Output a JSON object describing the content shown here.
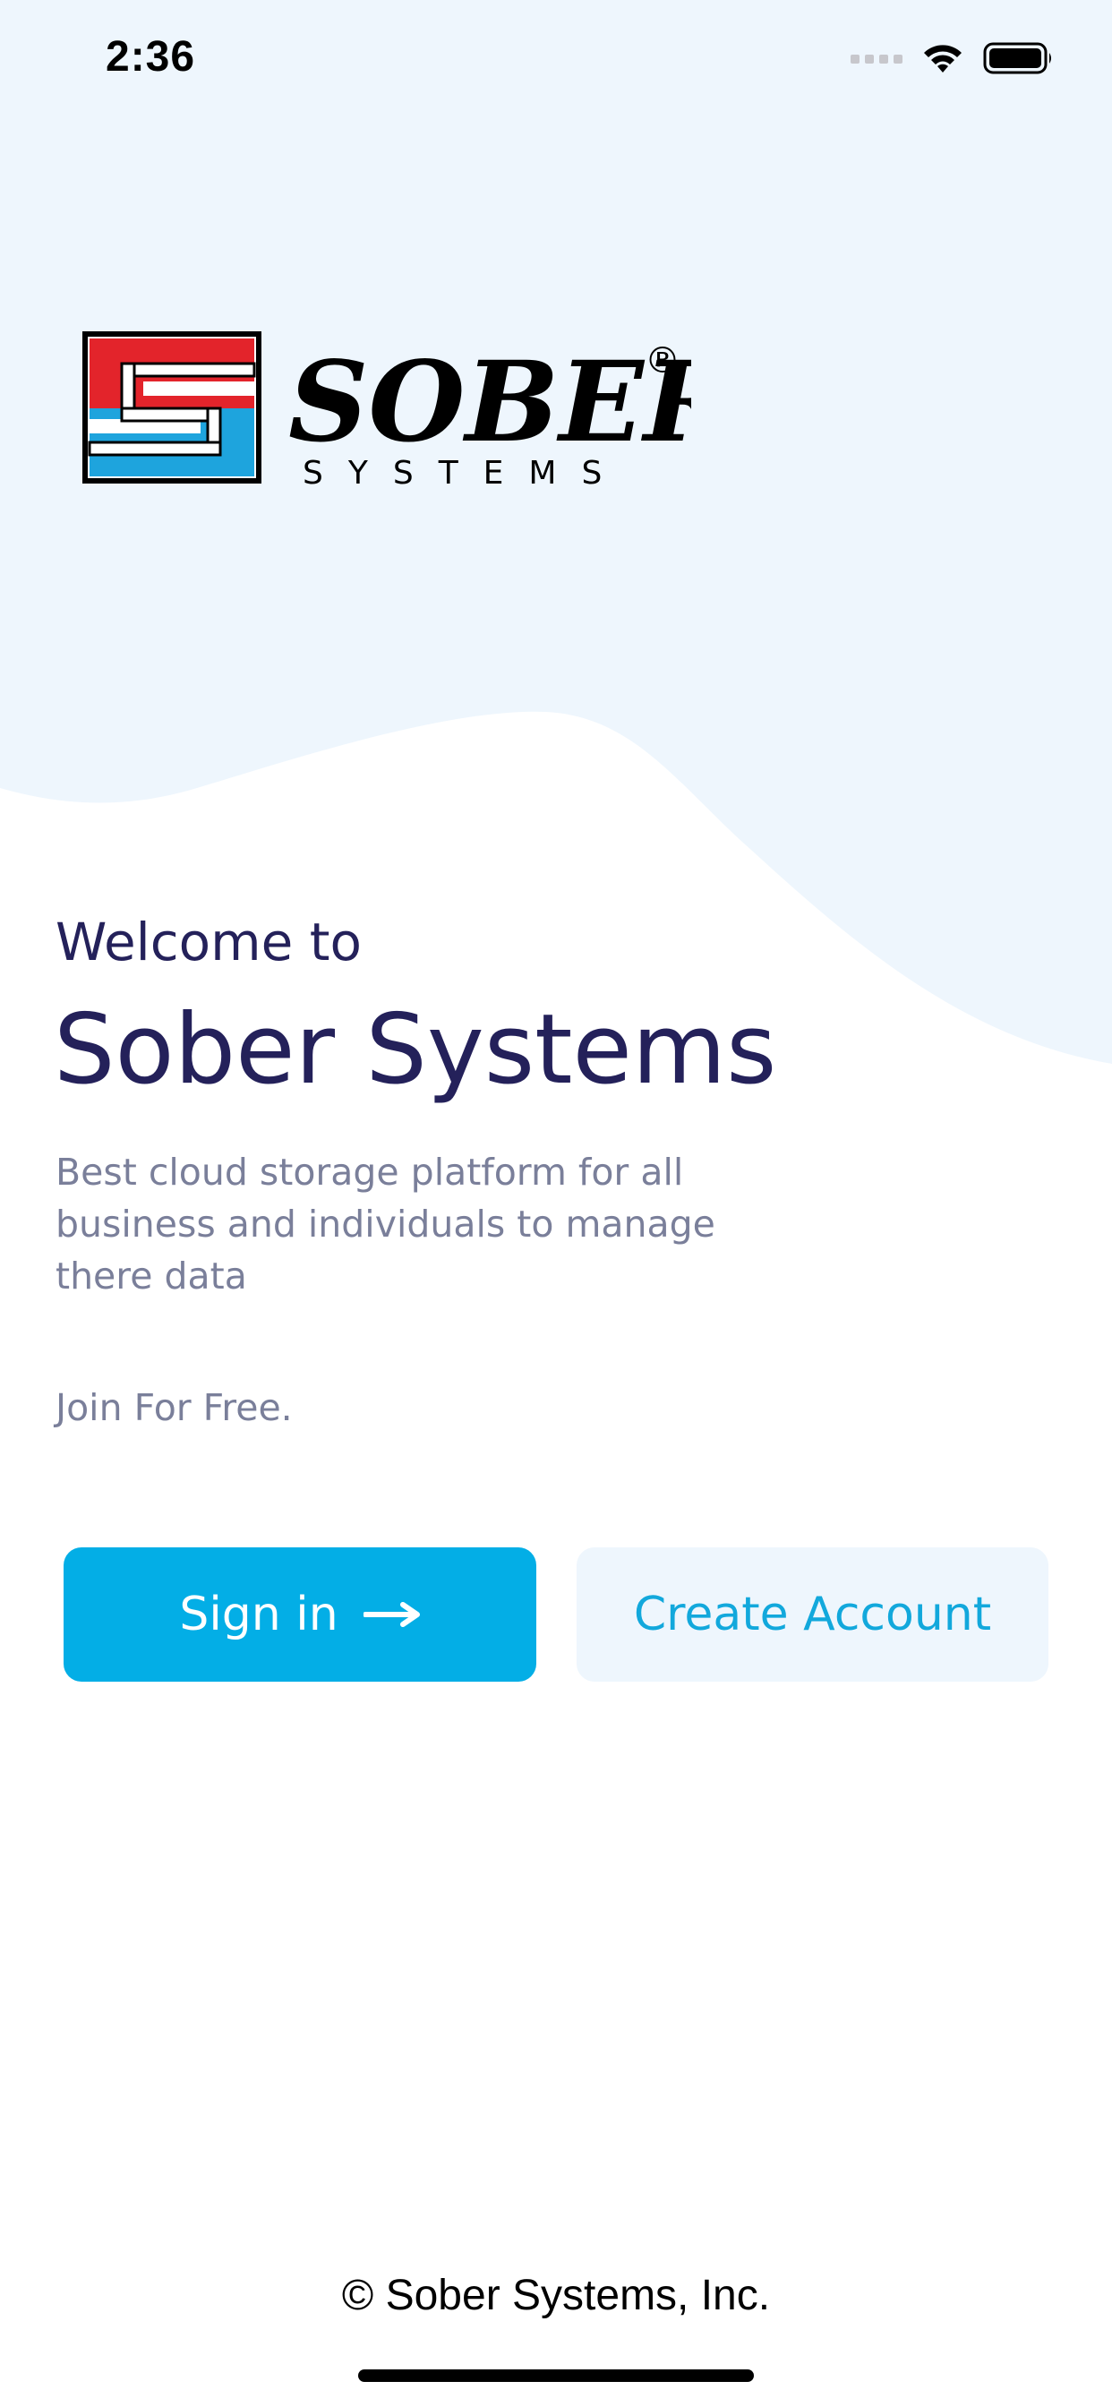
{
  "status_bar": {
    "time": "2:36",
    "icons": [
      "signal-dots-icon",
      "wifi-icon",
      "battery-icon"
    ]
  },
  "logo": {
    "wordmark": "SOBER",
    "subtitle": "SYSTEMS",
    "registered": "®",
    "colors": {
      "red": "#e3242b",
      "blue": "#1ea4dd",
      "black": "#000000"
    }
  },
  "welcome": {
    "subtitle": "Welcome to",
    "title": "Sober Systems",
    "description": "Best cloud storage platform for all business and individuals to manage there data",
    "join": "Join For Free."
  },
  "buttons": {
    "sign_in_label": "Sign in",
    "sign_in_icon": "arrow-right-icon",
    "create_account_label": "Create Account"
  },
  "footer": {
    "copyright": "© Sober Systems, Inc."
  },
  "theme": {
    "background_tint": "#eef6fd",
    "heading_color": "#24215a",
    "body_text_color": "#7a7f9a",
    "accent": "#03aee6"
  }
}
